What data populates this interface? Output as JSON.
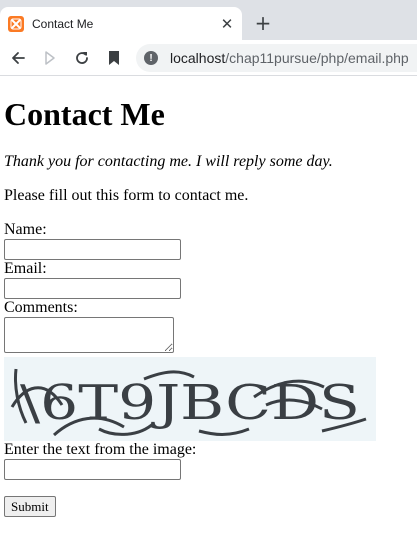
{
  "browser": {
    "tab": {
      "title": "Contact Me",
      "close_glyph": "✕"
    },
    "new_tab_glyph": "+",
    "url_host": "localhost",
    "url_path": "/chap11pursue/php/email.php",
    "info_glyph": "!"
  },
  "page": {
    "heading": "Contact Me",
    "thanks": "Thank you for contacting me. I will reply some day.",
    "instructions": "Please fill out this form to contact me.",
    "form": {
      "name_label": "Name:",
      "name_value": "",
      "email_label": "Email:",
      "email_value": "",
      "comments_label": "Comments:",
      "comments_value": "",
      "captcha_text": "\\6T9JBCDS",
      "captcha_label": "Enter the text from the image:",
      "captcha_value": "",
      "submit_label": "Submit"
    }
  },
  "colors": {
    "tabstrip": "#dee1e6",
    "favicon": "#fb7a24",
    "omnibox": "#f1f3f4",
    "captcha_bg": "#eef5f8",
    "captcha_ink": "#3a3f44"
  }
}
